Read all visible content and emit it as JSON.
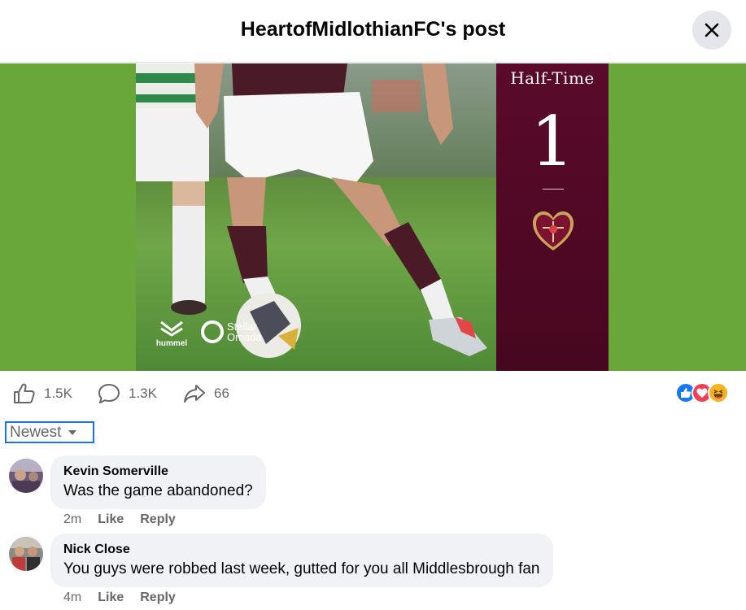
{
  "header": {
    "title": "HeartofMidlothianFC's post",
    "close_icon": "close-icon"
  },
  "media": {
    "score_label": "Half-Time",
    "score_value": "1",
    "crest_lettering": "H M F C 1874",
    "sponsor_hummel": "hummel",
    "sponsor_stellar_line1": "Stellar",
    "sponsor_stellar_line2": "Omada",
    "colors": {
      "panel": "#4f0925",
      "pitch": "#6aa73a"
    }
  },
  "stats": {
    "likes": "1.5K",
    "comments": "1.3K",
    "shares": "66",
    "reaction_icons": [
      "like-reaction-icon",
      "love-reaction-icon",
      "haha-reaction-icon"
    ]
  },
  "sort": {
    "label": "Newest"
  },
  "comments": [
    {
      "author": "Kevin Somerville",
      "text": "Was the game abandoned?",
      "time": "2m",
      "like": "Like",
      "reply": "Reply"
    },
    {
      "author": "Nick Close",
      "text": "You guys were robbed last week, gutted for you all Middlesbrough fan",
      "time": "4m",
      "like": "Like",
      "reply": "Reply"
    }
  ]
}
